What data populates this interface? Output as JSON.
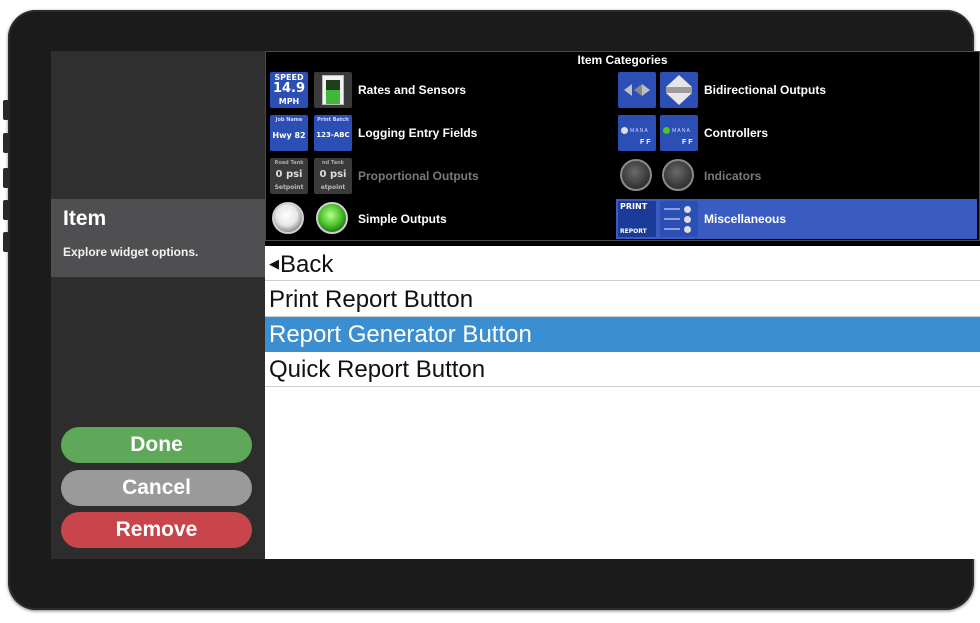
{
  "left_panel": {
    "title": "Item",
    "subtitle": "Explore widget options.",
    "buttons": {
      "done": "Done",
      "cancel": "Cancel",
      "remove": "Remove"
    }
  },
  "categories": {
    "title": "Item Categories",
    "items": [
      {
        "label": "Rates and Sensors",
        "state": "enabled"
      },
      {
        "label": "Bidirectional Outputs",
        "state": "enabled"
      },
      {
        "label": "Logging Entry Fields",
        "state": "enabled"
      },
      {
        "label": "Controllers",
        "state": "enabled"
      },
      {
        "label": "Proportional Outputs",
        "state": "disabled"
      },
      {
        "label": "Indicators",
        "state": "disabled"
      },
      {
        "label": "Simple Outputs",
        "state": "enabled"
      },
      {
        "label": "Miscellaneous",
        "state": "selected"
      }
    ],
    "thumbs": {
      "speed": {
        "label": "SPEED",
        "value": "14.9",
        "unit": "MPH"
      },
      "job_name": {
        "label": "Job Name",
        "value": "Hwy 82"
      },
      "print_batch": {
        "label": "Print Batch",
        "value": "123-ABC"
      },
      "road_tank": {
        "label": "Road Tank",
        "value": "0 psi",
        "sub": "Setpoint"
      },
      "tank2": {
        "label": "nd Tank",
        "value": "0 psi",
        "sub": "etpoint"
      },
      "print_report": {
        "top": "PRINT",
        "bottom": "REPORT"
      }
    }
  },
  "list": {
    "back_label": "Back",
    "items": [
      {
        "label": "Print Report Button"
      },
      {
        "label": "Report Generator Button"
      },
      {
        "label": "Quick Report Button"
      }
    ],
    "selected_index": 1
  },
  "colors": {
    "selected_row": "#3b8fd0",
    "category_selected": "#3a5bc0",
    "done": "#5fa85a",
    "cancel": "#9a9a9a",
    "remove": "#c8454b"
  },
  "icons": {
    "back": "triangle-left-icon",
    "bidirectional": "double-arrow-icon",
    "outputs": "round-button-icon"
  }
}
